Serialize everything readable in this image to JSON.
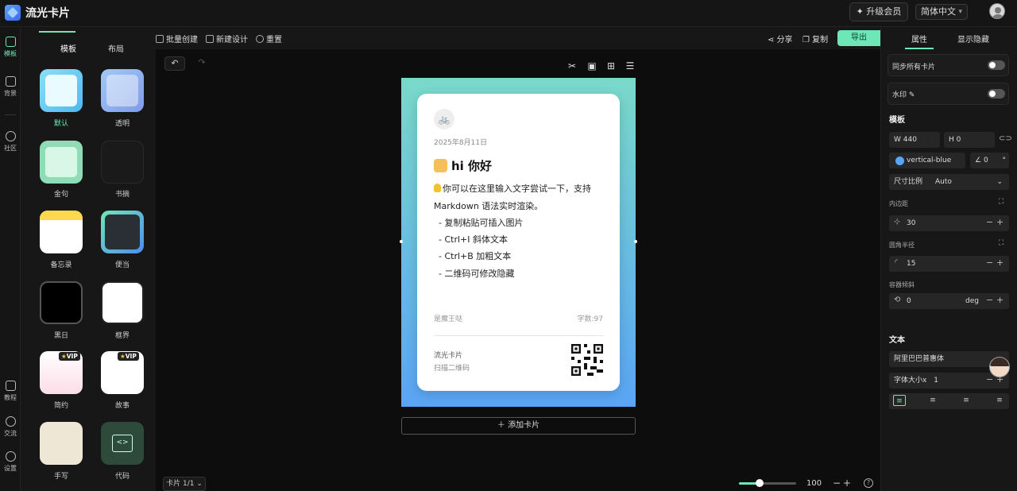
{
  "app": {
    "title": "流光卡片"
  },
  "topbar": {
    "upgrade_label": "升级会员",
    "language": "简体中文"
  },
  "rail": [
    {
      "label": "模板"
    },
    {
      "label": "背景"
    },
    {
      "label": "社区"
    },
    {
      "label": "教程"
    },
    {
      "label": "交流"
    },
    {
      "label": "设置"
    }
  ],
  "panel": {
    "tabs": [
      "模板",
      "布局"
    ],
    "templates": [
      {
        "label": "默认"
      },
      {
        "label": "透明"
      },
      {
        "label": "金句"
      },
      {
        "label": "书摘"
      },
      {
        "label": "备忘录"
      },
      {
        "label": "便当"
      },
      {
        "label": "黑日"
      },
      {
        "label": "框界"
      },
      {
        "label": "简约",
        "badge": "VIP"
      },
      {
        "label": "故事",
        "badge": "VIP"
      },
      {
        "label": "手写"
      },
      {
        "label": "代码"
      }
    ]
  },
  "toolbar": {
    "batch_create": "批量创建",
    "new_design": "新建设计",
    "reset": "重置",
    "share": "分享",
    "copy": "复制",
    "export": "导出"
  },
  "card": {
    "date": "2025年8月11日",
    "heading": "hi 你好",
    "body_lines": [
      "你可以在这里输入文字尝试一下，支持",
      "Markdown 语法实时渲染。",
      "- 复制粘贴可插入图片",
      "- Ctrl+I 斜体文本",
      "- Ctrl+B 加粗文本",
      "- 二维码可修改隐藏"
    ],
    "author": "是魔王哒",
    "word_count": "字数:97",
    "brand": "流光卡片",
    "scan": "扫描二维码"
  },
  "canvas": {
    "add_card": "添加卡片",
    "pager": "卡片 1/1",
    "zoom": "100",
    "zoom_fraction": 0.36
  },
  "right": {
    "tabs": [
      "属性",
      "显示隐藏"
    ],
    "sync_all": "同步所有卡片",
    "watermark": "水印",
    "template_section": "模板",
    "width": "W 440",
    "height": "H 0",
    "gradient": "vertical-blue",
    "angle": "0",
    "angle_unit": "°",
    "ratio_label": "尺寸比例",
    "ratio_value": "Auto",
    "padding_label": "内边距",
    "padding_value": "30",
    "radius_label": "圆角半径",
    "radius_value": "15",
    "tilt_label": "容器倾斜",
    "tilt_value": "0",
    "tilt_unit": "deg",
    "text_section": "文本",
    "font": "阿里巴巴普惠体",
    "font_size_label": "字体大小x",
    "font_size_value": "1"
  },
  "colors": {
    "accent": "#6ee7b7",
    "gradient_top": "#79d9c9",
    "gradient_bottom": "#5aa4f5"
  }
}
